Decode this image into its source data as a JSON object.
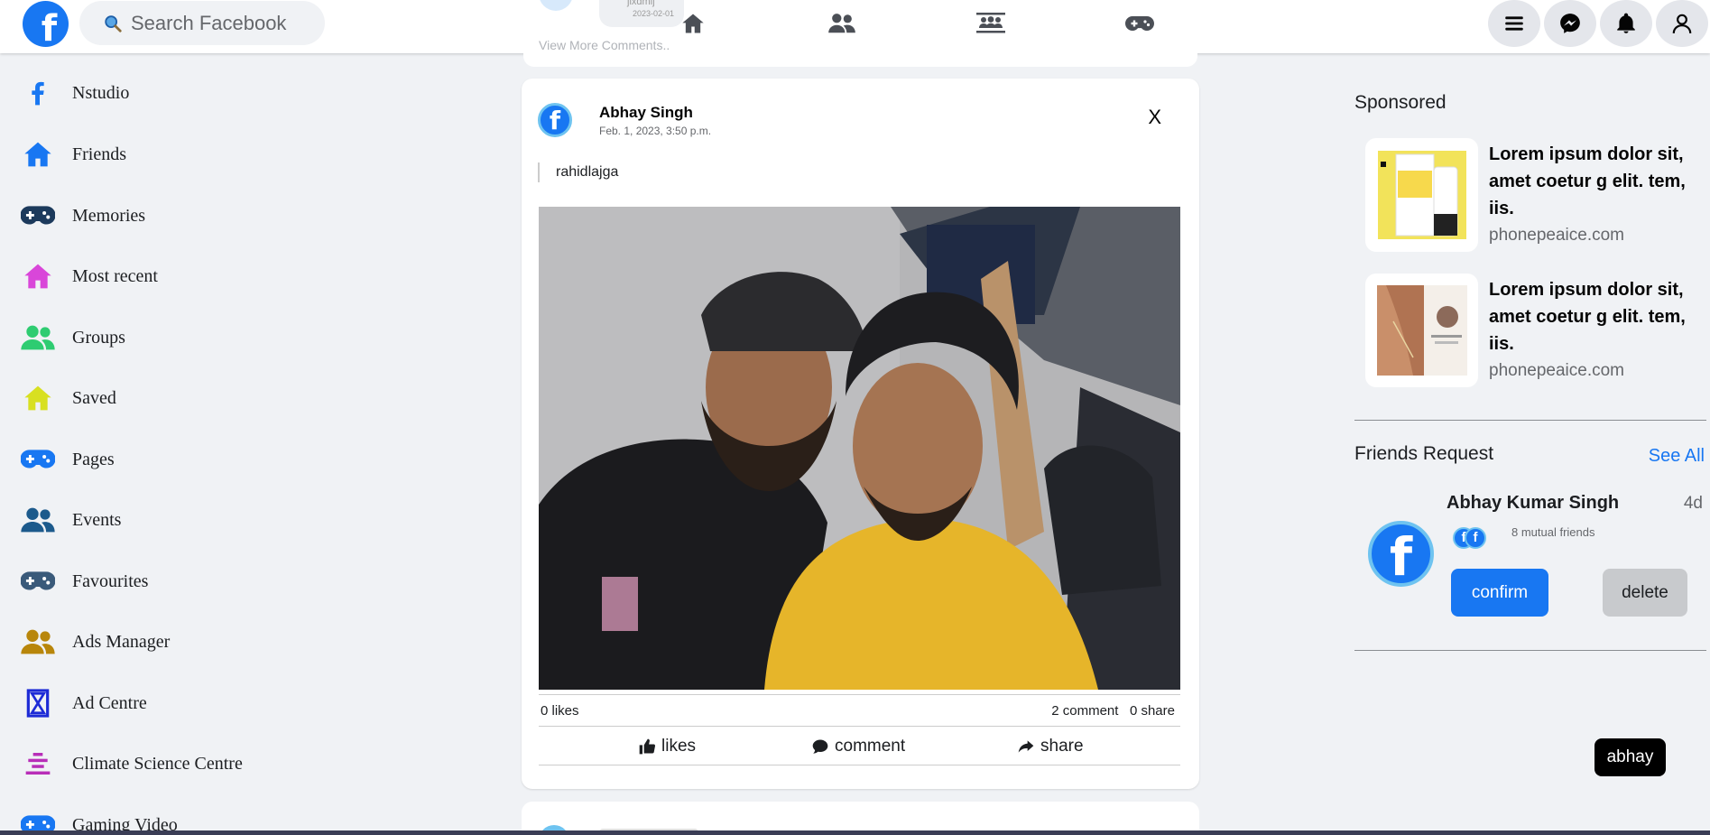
{
  "header": {
    "logo_letter": "f",
    "search_placeholder": "Search Facebook"
  },
  "feed_peek": {
    "commenter_name": "jlxdmlj",
    "comment_date": "2023-02-01",
    "view_more_label": "View More Comments.."
  },
  "center_nav": [
    "home-icon",
    "friends-icon",
    "groups-icon",
    "gaming-icon"
  ],
  "header_right": [
    "menu-icon",
    "messenger-icon",
    "notifications-icon",
    "account-icon"
  ],
  "sidebar": {
    "items": [
      {
        "label": "Nstudio",
        "icon": "facebook-f-icon",
        "color": "#1877f2"
      },
      {
        "label": "Friends",
        "icon": "home-icon",
        "color": "#1877f2"
      },
      {
        "label": "Memories",
        "icon": "gamepad-icon",
        "color": "#1c3a5c"
      },
      {
        "label": "Most recent",
        "icon": "home-icon",
        "color": "#d946d9"
      },
      {
        "label": "Groups",
        "icon": "users-icon",
        "color": "#2ecc71"
      },
      {
        "label": "Saved",
        "icon": "home-icon",
        "color": "#d8e021"
      },
      {
        "label": "Pages",
        "icon": "gamepad-icon",
        "color": "#1877f2"
      },
      {
        "label": "Events",
        "icon": "users-icon",
        "color": "#1c5a8c"
      },
      {
        "label": "Favourites",
        "icon": "gamepad-icon",
        "color": "#3a5a7a"
      },
      {
        "label": "Ads Manager",
        "icon": "users-icon",
        "color": "#b8860b"
      },
      {
        "label": "Ad Centre",
        "icon": "hourglass-icon",
        "color": "#1d2bd6"
      },
      {
        "label": "Climate Science Centre",
        "icon": "climate-icon",
        "color": "#b82eb8"
      },
      {
        "label": "Gaming Video",
        "icon": "gamepad-icon",
        "color": "#1877f2"
      }
    ]
  },
  "post": {
    "author": "Abhay Singh",
    "date": "Feb. 1, 2023, 3:50 p.m.",
    "close_label": "X",
    "caption": "rahidlajga",
    "likes_count": "0 likes",
    "comments_count": "2 comment",
    "shares_count": "0 share",
    "actions": {
      "like": "likes",
      "comment": "comment",
      "share": "share"
    }
  },
  "right": {
    "sponsored_title": "Sponsored",
    "ads": [
      {
        "text": "Lorem ipsum dolor sit, amet coetur g elit. tem, iis.",
        "link": "phonepeaice.com"
      },
      {
        "text": "Lorem ipsum dolor sit, amet coetur g elit. tem, iis.",
        "link": "phonepeaice.com"
      }
    ],
    "friends_request_title": "Friends Request",
    "see_all": "See All",
    "request": {
      "name": "Abhay Kumar Singh",
      "time": "4d",
      "mutual": "8 mutual friends",
      "confirm": "confirm",
      "delete": "delete"
    },
    "user_chip": "abhay"
  },
  "colors": {
    "accent": "#1877f2",
    "bg": "#f0f2f5"
  }
}
